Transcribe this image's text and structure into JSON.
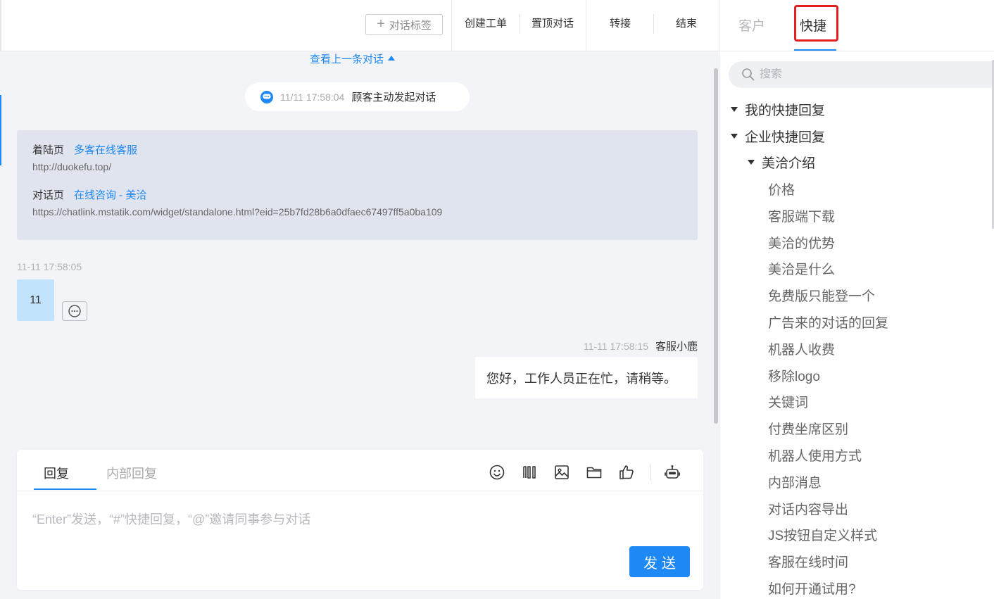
{
  "header": {
    "tag_button_label": "对话标签",
    "actions": [
      "创建工单",
      "置顶对话",
      "转接",
      "结束"
    ]
  },
  "chat": {
    "prev_link": "查看上一条对话",
    "system_notice": {
      "time": "11/11 17:58:04",
      "text": "顾客主动发起对话"
    },
    "visit_info": {
      "landing_label": "着陆页",
      "landing_title": "多客在线客服",
      "landing_url": "http://duokefu.top/",
      "chat_page_label": "对话页",
      "chat_page_title": "在线咨询 - 美洽",
      "chat_page_url": "https://chatlink.mstatik.com/widget/standalone.html?eid=25b7fd28b6a0dfaec67497ff5a0ba109"
    },
    "messages": [
      {
        "time": "11-11 17:58:05",
        "text": "11"
      },
      {
        "time": "11-11 17:58:15",
        "sender": "客服小鹿",
        "text": "您好，工作人员正在忙，请稍等。"
      }
    ]
  },
  "composer": {
    "tabs": [
      "回复",
      "内部回复"
    ],
    "placeholder": "“Enter”发送，“#”快捷回复，“@”邀请同事参与对话",
    "send_label": "发送",
    "tools": [
      "emoji-icon",
      "quick-text-icon",
      "image-icon",
      "folder-icon",
      "thumbs-up-icon",
      "robot-icon"
    ]
  },
  "right_panel": {
    "tabs": [
      "客户",
      "快捷"
    ],
    "search_placeholder": "搜索",
    "tree": {
      "my_replies": "我的快捷回复",
      "company_replies": "企业快捷回复",
      "group": "美洽介绍",
      "items": [
        "价格",
        "客服端下载",
        "美洽的优势",
        "美洽是什么",
        "免费版只能登一个",
        "广告来的对话的回复",
        "机器人收费",
        "移除logo",
        "关键词",
        "付费坐席区别",
        "机器人使用方式",
        "内部消息",
        "对话内容导出",
        "JS按钮自定义样式",
        "客服在线时间",
        "如何开通试用?"
      ]
    }
  },
  "colors": {
    "accent": "#1e88f5",
    "highlight_box": "#e32020",
    "customer_bubble": "#c2e3fc",
    "info_card": "#e0e4ee"
  }
}
